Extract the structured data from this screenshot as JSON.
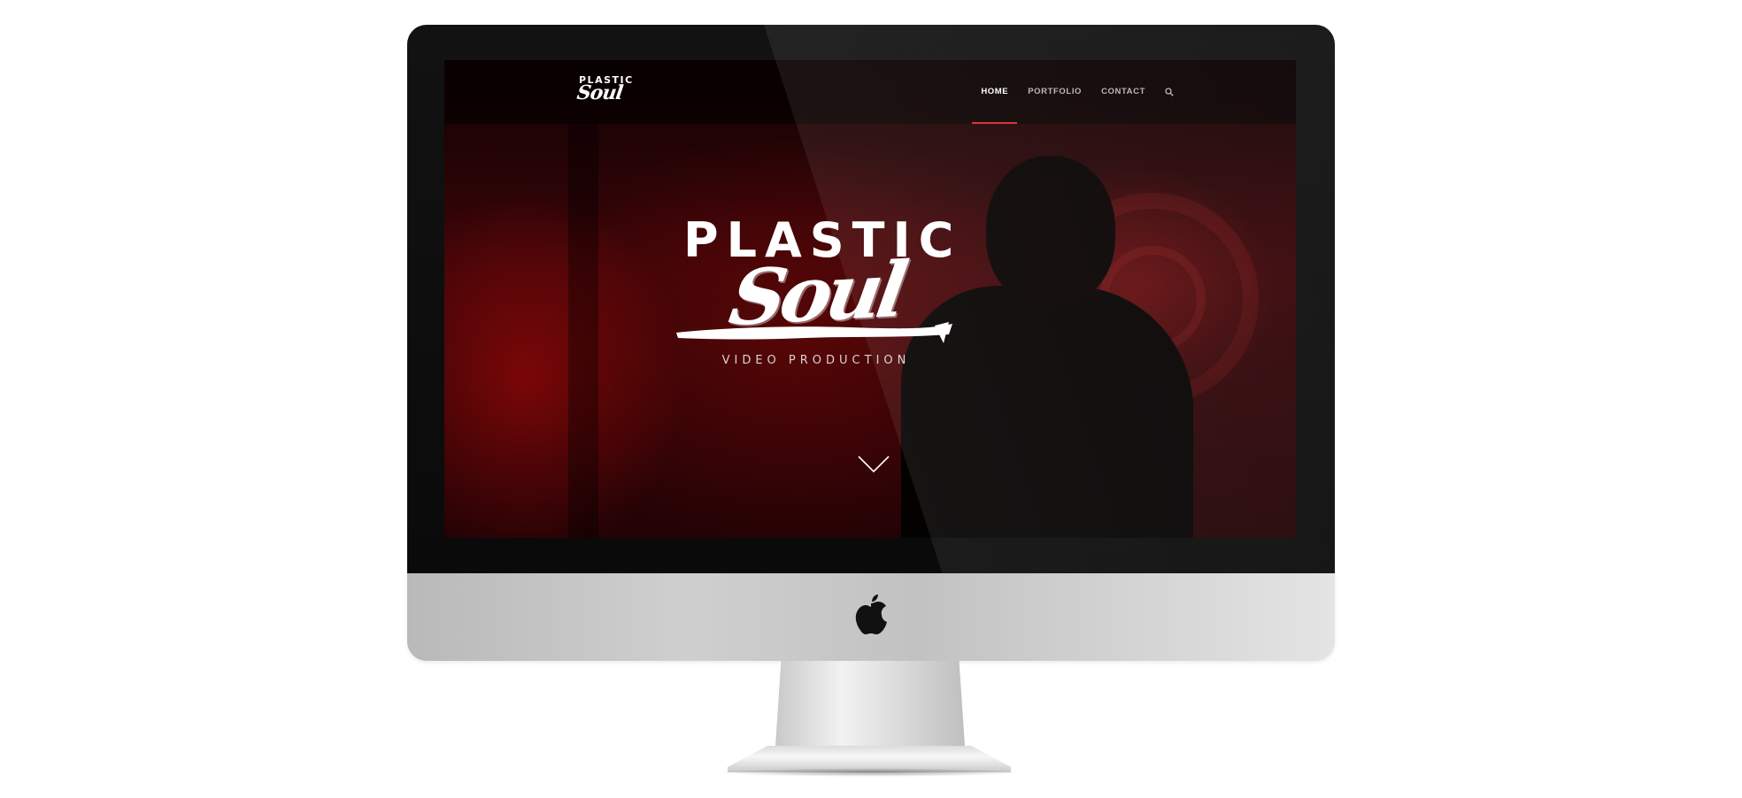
{
  "site": {
    "nav_logo": {
      "top": "PLASTIC",
      "script": "Soul"
    },
    "nav": [
      {
        "label": "HOME",
        "active": true
      },
      {
        "label": "PORTFOLIO",
        "active": false
      },
      {
        "label": "CONTACT",
        "active": false
      }
    ],
    "hero": {
      "title_top": "PLASTIC",
      "title_script": "Soul",
      "tagline": "VIDEO PRODUCTION"
    },
    "icons": {
      "search": "search-icon",
      "scroll": "chevron-down-icon",
      "apple": "apple-logo-icon"
    },
    "colors": {
      "accent": "#d62b2b",
      "hero_red": "#8a0a0a",
      "nav_text": "#b9b2b2"
    }
  }
}
